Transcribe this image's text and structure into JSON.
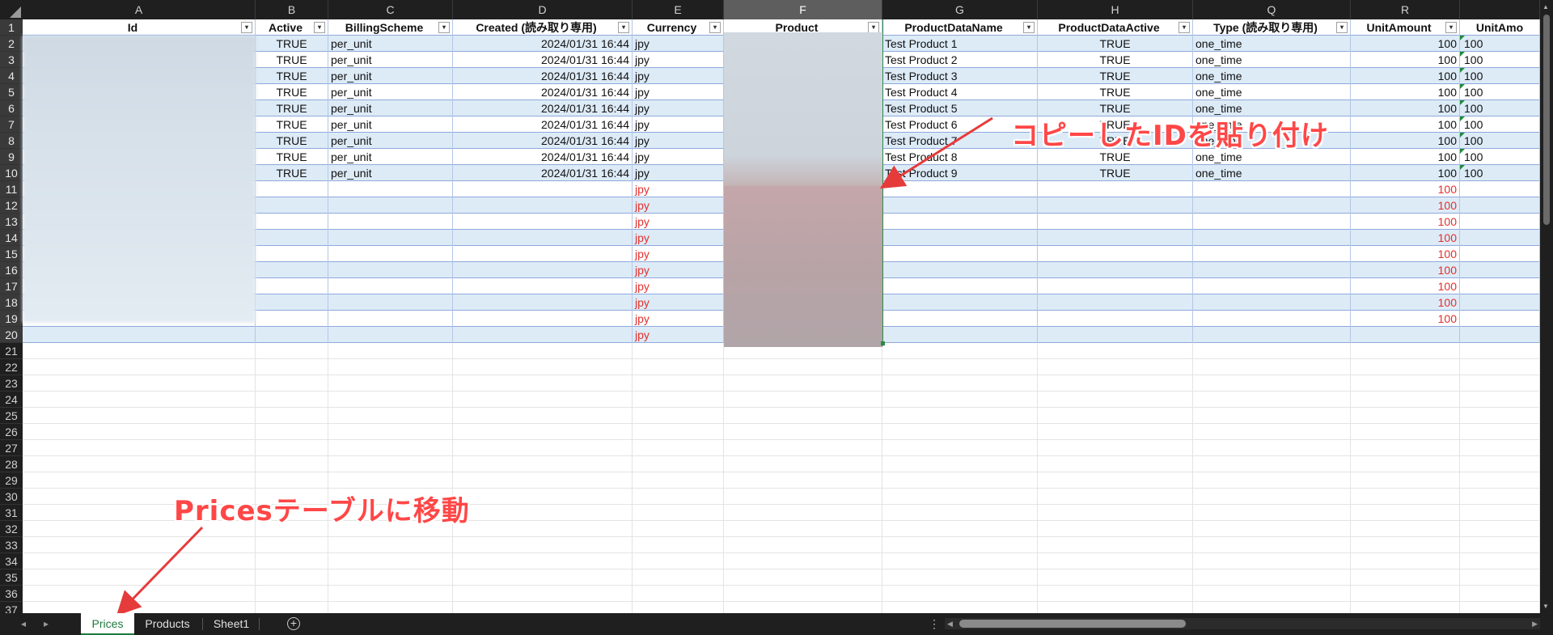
{
  "columns": [
    {
      "letter": "A",
      "header": "Id",
      "filter": true,
      "selected": false
    },
    {
      "letter": "B",
      "header": "Active",
      "filter": true,
      "selected": false
    },
    {
      "letter": "C",
      "header": "BillingScheme",
      "filter": true,
      "selected": false
    },
    {
      "letter": "D",
      "header": "Created (読み取り専用)",
      "filter": true,
      "selected": false
    },
    {
      "letter": "E",
      "header": "Currency",
      "filter": true,
      "selected": false
    },
    {
      "letter": "F",
      "header": "Product",
      "filter": true,
      "selected": true
    },
    {
      "letter": "G",
      "header": "ProductDataName",
      "filter": true,
      "selected": false
    },
    {
      "letter": "H",
      "header": "ProductDataActive",
      "filter": true,
      "selected": false
    },
    {
      "letter": "Q",
      "header": "Type (読み取り専用)",
      "filter": true,
      "selected": false
    },
    {
      "letter": "R",
      "header": "UnitAmount",
      "filter": true,
      "selected": false
    },
    {
      "letter": "",
      "header": "UnitAmo",
      "filter": false,
      "selected": false
    }
  ],
  "data_rows": [
    {
      "row": 2,
      "active": "TRUE",
      "billing": "per_unit",
      "created": "2024/01/31 16:44",
      "currency": "jpy",
      "name": "Test Product 1",
      "pactive": "TRUE",
      "type": "one_time",
      "amount": "100",
      "amount2": "100"
    },
    {
      "row": 3,
      "active": "TRUE",
      "billing": "per_unit",
      "created": "2024/01/31 16:44",
      "currency": "jpy",
      "name": "Test Product 2",
      "pactive": "TRUE",
      "type": "one_time",
      "amount": "100",
      "amount2": "100"
    },
    {
      "row": 4,
      "active": "TRUE",
      "billing": "per_unit",
      "created": "2024/01/31 16:44",
      "currency": "jpy",
      "name": "Test Product 3",
      "pactive": "TRUE",
      "type": "one_time",
      "amount": "100",
      "amount2": "100"
    },
    {
      "row": 5,
      "active": "TRUE",
      "billing": "per_unit",
      "created": "2024/01/31 16:44",
      "currency": "jpy",
      "name": "Test Product 4",
      "pactive": "TRUE",
      "type": "one_time",
      "amount": "100",
      "amount2": "100"
    },
    {
      "row": 6,
      "active": "TRUE",
      "billing": "per_unit",
      "created": "2024/01/31 16:44",
      "currency": "jpy",
      "name": "Test Product 5",
      "pactive": "TRUE",
      "type": "one_time",
      "amount": "100",
      "amount2": "100"
    },
    {
      "row": 7,
      "active": "TRUE",
      "billing": "per_unit",
      "created": "2024/01/31 16:44",
      "currency": "jpy",
      "name": "Test Product 6",
      "pactive": "TRUE",
      "type": "one_time",
      "amount": "100",
      "amount2": "100"
    },
    {
      "row": 8,
      "active": "TRUE",
      "billing": "per_unit",
      "created": "2024/01/31 16:44",
      "currency": "jpy",
      "name": "Test Product 7",
      "pactive": "TRUE",
      "type": "one_time",
      "amount": "100",
      "amount2": "100"
    },
    {
      "row": 9,
      "active": "TRUE",
      "billing": "per_unit",
      "created": "2024/01/31 16:44",
      "currency": "jpy",
      "name": "Test Product 8",
      "pactive": "TRUE",
      "type": "one_time",
      "amount": "100",
      "amount2": "100"
    },
    {
      "row": 10,
      "active": "TRUE",
      "billing": "per_unit",
      "created": "2024/01/31 16:44",
      "currency": "jpy",
      "name": "Test Product 9",
      "pactive": "TRUE",
      "type": "one_time",
      "amount": "100",
      "amount2": "100"
    }
  ],
  "new_rows": [
    {
      "row": 11,
      "currency": "jpy",
      "amount": "100"
    },
    {
      "row": 12,
      "currency": "jpy",
      "amount": "100"
    },
    {
      "row": 13,
      "currency": "jpy",
      "amount": "100"
    },
    {
      "row": 14,
      "currency": "jpy",
      "amount": "100"
    },
    {
      "row": 15,
      "currency": "jpy",
      "amount": "100"
    },
    {
      "row": 16,
      "currency": "jpy",
      "amount": "100"
    },
    {
      "row": 17,
      "currency": "jpy",
      "amount": "100"
    },
    {
      "row": 18,
      "currency": "jpy",
      "amount": "100"
    },
    {
      "row": 19,
      "currency": "jpy",
      "amount": "100"
    },
    {
      "row": 20,
      "currency": "jpy",
      "amount": ""
    }
  ],
  "empty_row_numbers": [
    21,
    22,
    23,
    24,
    25,
    26,
    27,
    28,
    29,
    30,
    31,
    32,
    33,
    34,
    35,
    36,
    37
  ],
  "annotations": {
    "paste_label": "コピーしたIDを貼り付け",
    "move_label": "Pricesテーブルに移動"
  },
  "colors": {
    "annotation": "#ff4747",
    "table_band": "#ddebf7",
    "new_value_red": "#e0312d",
    "active_tab": "#1e7a3c"
  },
  "tabs": [
    {
      "label": "Prices",
      "active": true
    },
    {
      "label": "Products",
      "active": false
    },
    {
      "label": "Sheet1",
      "active": false
    }
  ],
  "icons": {
    "nav_prev": "◂",
    "nav_next": "▸",
    "add_sheet": "+",
    "more": "⋮",
    "filter": "▾"
  }
}
